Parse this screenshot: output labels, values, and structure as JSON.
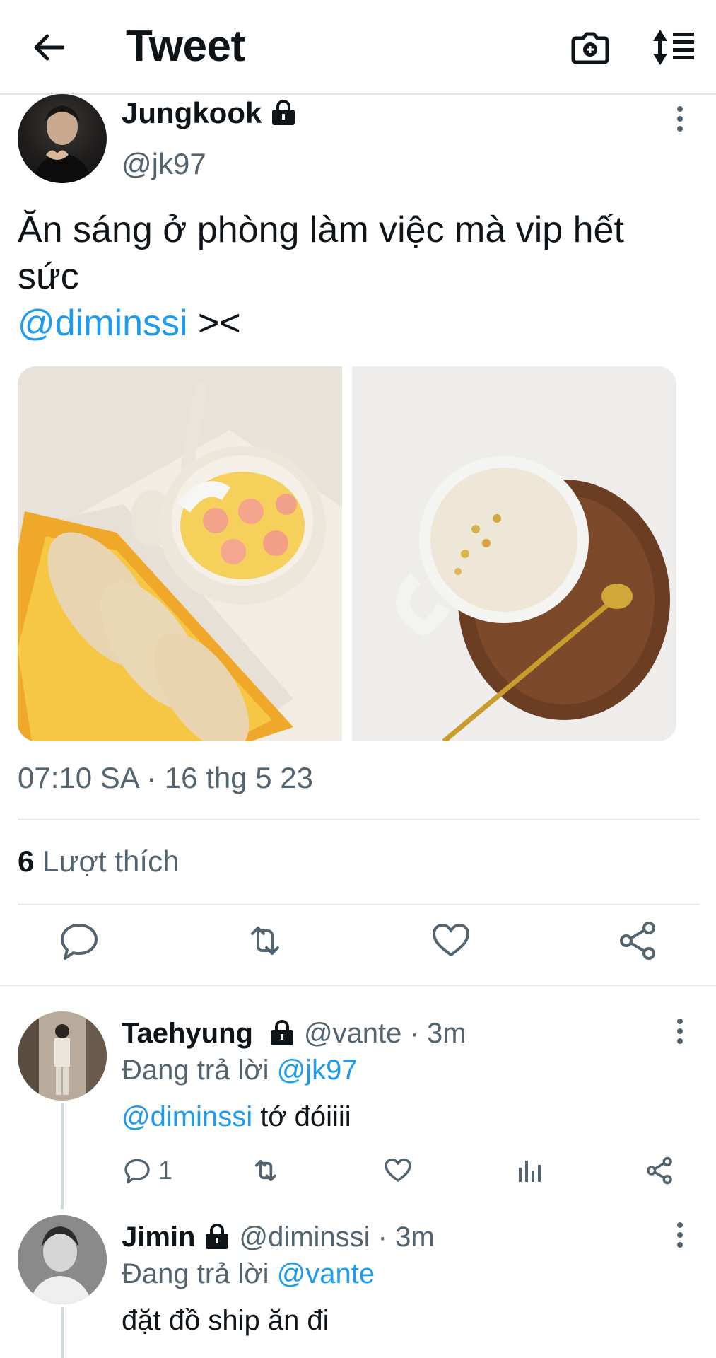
{
  "header": {
    "title": "Tweet",
    "back_icon": "arrow-left-icon",
    "camera_icon": "camera-icon",
    "sort_icon": "sort-icon"
  },
  "tweet": {
    "author_name": "Jungkook",
    "author_handle": "@jk97",
    "text_line1": "Ăn sáng ở phòng làm việc mà vip hết",
    "text_line2": "sức",
    "mention": "@diminssi",
    "text_tail": " ><",
    "timestamp": "07:10 SA · 16 thg 5 23",
    "likes_count": "6",
    "likes_label": " Lượt thích"
  },
  "replies": [
    {
      "name": "Taehyung",
      "handle_time": "@vante · 3m",
      "replying_label": "Đang trả lời ",
      "replying_to": "@jk97",
      "mention": "@diminssi",
      "text": " tớ đóiiii",
      "reply_count": "1"
    },
    {
      "name": "Jimin",
      "handle_time": "@diminssi · 3m",
      "replying_label": "Đang trả lời ",
      "replying_to": "@vante",
      "text": "đặt đồ ship ăn đi"
    }
  ],
  "colors": {
    "link": "#1d9bf0",
    "muted": "#536471",
    "text": "#0f1419",
    "divider": "#e1e5e8"
  }
}
